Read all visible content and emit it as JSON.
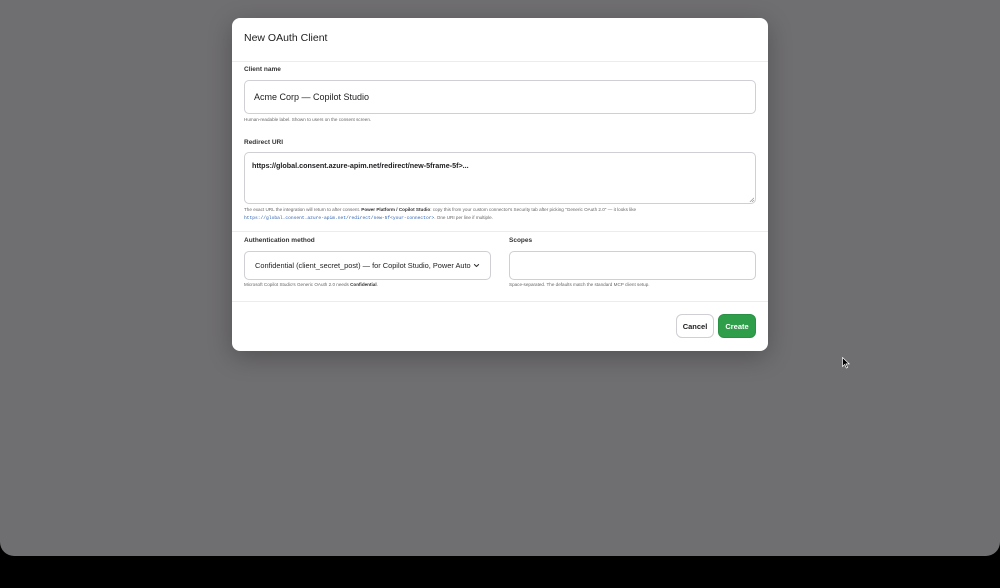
{
  "dialog": {
    "title": "New OAuth Client",
    "client_name": {
      "label": "Client name",
      "value": "Acme Corp — Copilot Studio",
      "help": "Human-readable label. Shown to users on the consent screen."
    },
    "redirect_uri": {
      "label": "Redirect URI",
      "value": "https://global.consent.azure-apim.net/redirect/new-5frame-5f>...",
      "help_part1": "The exact URL the integration will return to after consent. ",
      "help_bold": "Power Platform / Copilot Studio",
      "help_part2": ": copy this from your custom connector's Security tab after picking \"Generic OAuth 2.0\" — it looks like",
      "help_code": "https://global.consent.azure-apim.net/redirect/new-5f<your-connector>",
      "help_part3": ". One URI per line if multiple."
    },
    "auth_method": {
      "label": "Authentication method",
      "selected": "Confidential (client_secret_post) — for Copilot Studio, Power Auto",
      "help_part1": "Microsoft Copilot Studio's Generic OAuth 2.0 needs ",
      "help_bold": "Confidential",
      "help_part2": "."
    },
    "scopes": {
      "label": "Scopes",
      "value": "",
      "help": "Space-separated. The defaults match the standard MCP client setup."
    },
    "buttons": {
      "cancel": "Cancel",
      "create": "Create"
    }
  },
  "colors": {
    "backdrop": "#6f6e70",
    "primary_button": "#2e9e4a",
    "link_code": "#2a5db0"
  },
  "icons": {
    "select_arrow": "chevron-down-icon",
    "cursor": "mouse-pointer-icon",
    "textarea_grip": "resize-grip-icon"
  }
}
